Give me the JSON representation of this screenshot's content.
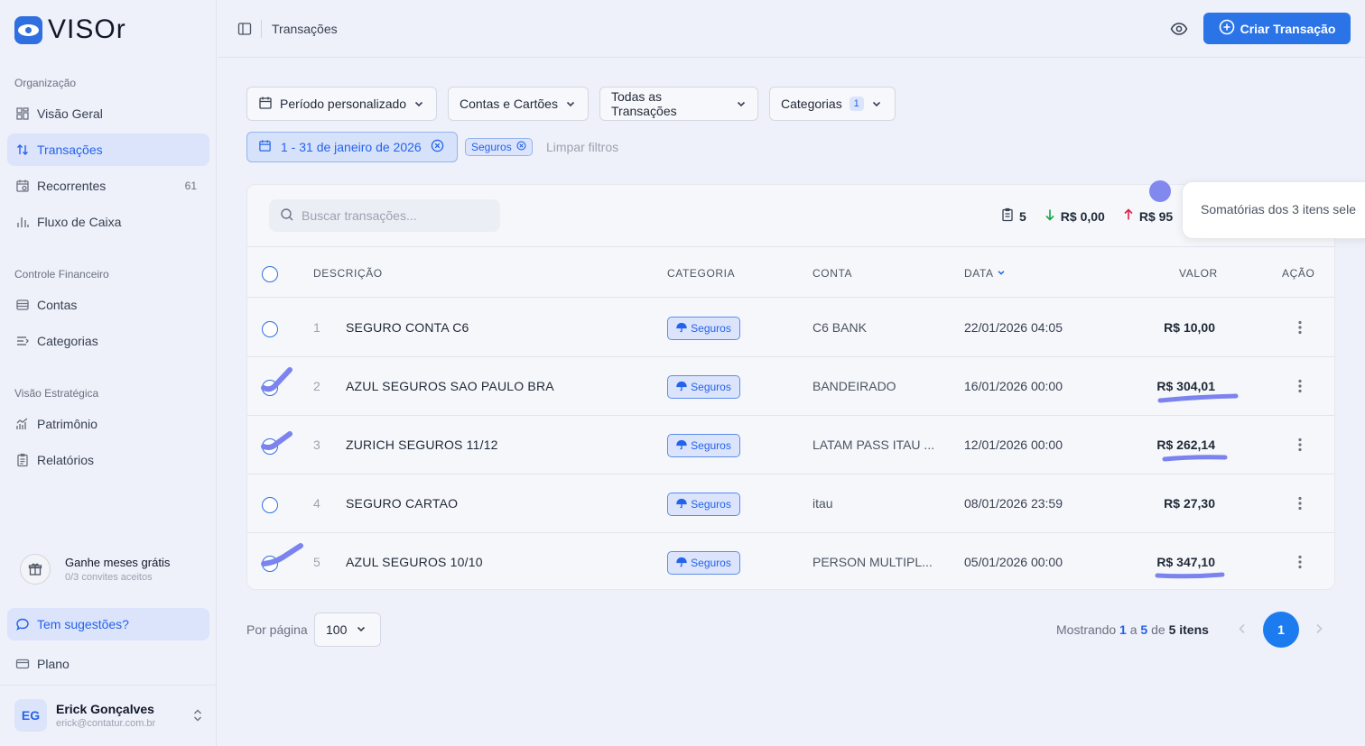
{
  "brand": {
    "name": "VISOr"
  },
  "sidebar": {
    "sections": [
      {
        "label": "Organização"
      },
      {
        "label": "Controle Financeiro"
      },
      {
        "label": "Visão Estratégica"
      }
    ],
    "items": [
      {
        "label": "Visão Geral",
        "icon": "dashboard-icon"
      },
      {
        "label": "Transações",
        "icon": "arrows-up-down-icon",
        "active": true
      },
      {
        "label": "Recorrentes",
        "icon": "calendar-repeat-icon",
        "count": "61"
      },
      {
        "label": "Fluxo de Caixa",
        "icon": "bar-chart-icon"
      },
      {
        "label": "Contas",
        "icon": "wallet-icon"
      },
      {
        "label": "Categorias",
        "icon": "list-icon"
      },
      {
        "label": "Patrimônio",
        "icon": "chart-line-icon"
      },
      {
        "label": "Relatórios",
        "icon": "clipboard-icon"
      }
    ],
    "promo": {
      "title": "Ganhe meses grátis",
      "subtitle": "0/3 convites aceitos"
    },
    "suggestions": "Tem sugestões?",
    "plan": "Plano",
    "user": {
      "initials": "EG",
      "name": "Erick Gonçalves",
      "email": "erick@contatur.com.br"
    }
  },
  "header": {
    "breadcrumb": "Transações",
    "create_button": "Criar Transação"
  },
  "filters": {
    "period": "Período personalizado",
    "accounts": "Contas e Cartões",
    "types": "Todas as Transações",
    "categories": "Categorias",
    "categories_count": "1",
    "date_range": "1 - 31 de janeiro de 2026",
    "category_tag": "Seguros",
    "clear": "Limpar filtros"
  },
  "table": {
    "search_placeholder": "Buscar transações...",
    "stats": {
      "count": "5",
      "income": "R$ 0,00",
      "expense": "R$ 95"
    },
    "columns": {
      "description": "DESCRIÇÃO",
      "category": "CATEGORIA",
      "account": "CONTA",
      "date": "DATA",
      "value": "VALOR",
      "action": "AÇÃO"
    },
    "rows": [
      {
        "num": "1",
        "description": "SEGURO CONTA C6",
        "category": "Seguros",
        "account": "C6 BANK",
        "date": "22/01/2026 04:05",
        "value": "R$ 10,00",
        "selected": false
      },
      {
        "num": "2",
        "description": "AZUL SEGUROS SAO PAULO BRA",
        "category": "Seguros",
        "account": "BANDEIRADO",
        "date": "16/01/2026 00:00",
        "value": "R$ 304,01",
        "selected": true
      },
      {
        "num": "3",
        "description": "ZURICH SEGUROS 11/12",
        "category": "Seguros",
        "account": "LATAM PASS ITAU ...",
        "date": "12/01/2026 00:00",
        "value": "R$ 262,14",
        "selected": true
      },
      {
        "num": "4",
        "description": "SEGURO CARTAO",
        "category": "Seguros",
        "account": "itau",
        "date": "08/01/2026 23:59",
        "value": "R$ 27,30",
        "selected": false
      },
      {
        "num": "5",
        "description": "AZUL SEGUROS 10/10",
        "category": "Seguros",
        "account": "PERSON MULTIPL...",
        "date": "05/01/2026 00:00",
        "value": "R$ 347,10",
        "selected": true
      }
    ]
  },
  "tooltip": "Somatórias dos 3 itens sele",
  "pagination": {
    "per_page_label": "Por página",
    "per_page": "100",
    "showing_prefix": "Mostrando",
    "from": "1",
    "sep_a": "a",
    "to": "5",
    "sep_de": "de",
    "total": "5 itens",
    "current_page": "1"
  },
  "colors": {
    "accent": "#2a74e8",
    "annotation": "#7b83ee"
  }
}
